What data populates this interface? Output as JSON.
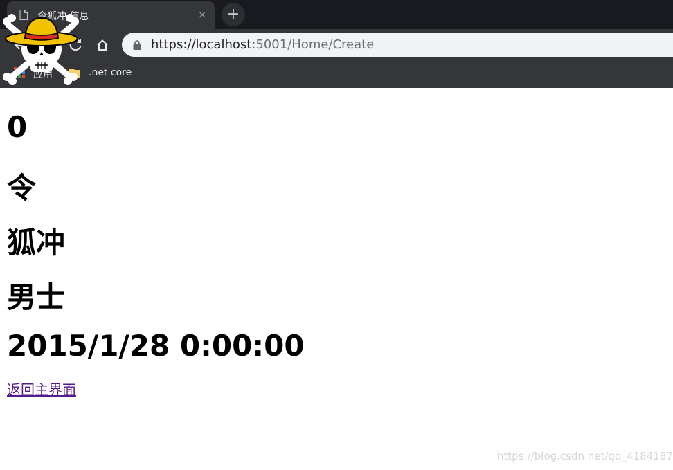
{
  "browser": {
    "tab_title": "令狐冲 信息",
    "tab_close": "×",
    "new_tab": "+",
    "url_host": "https://localhost",
    "url_rest": ":5001/Home/Create",
    "bookmarks": [
      {
        "label": "应用",
        "icon": "apps-grid-icon"
      },
      {
        "label": ".net core",
        "icon": "folder-icon"
      }
    ]
  },
  "page": {
    "fields": [
      "0",
      "令",
      "狐冲",
      "男士",
      "2015/1/28 0:00:00"
    ],
    "back_link": "返回主界面"
  },
  "watermark": "https://blog.csdn.net/qq_41841878",
  "colors": {
    "link": "#551a8b",
    "chrome_dark": "#202124",
    "omnibox": "#f1f3f4"
  }
}
